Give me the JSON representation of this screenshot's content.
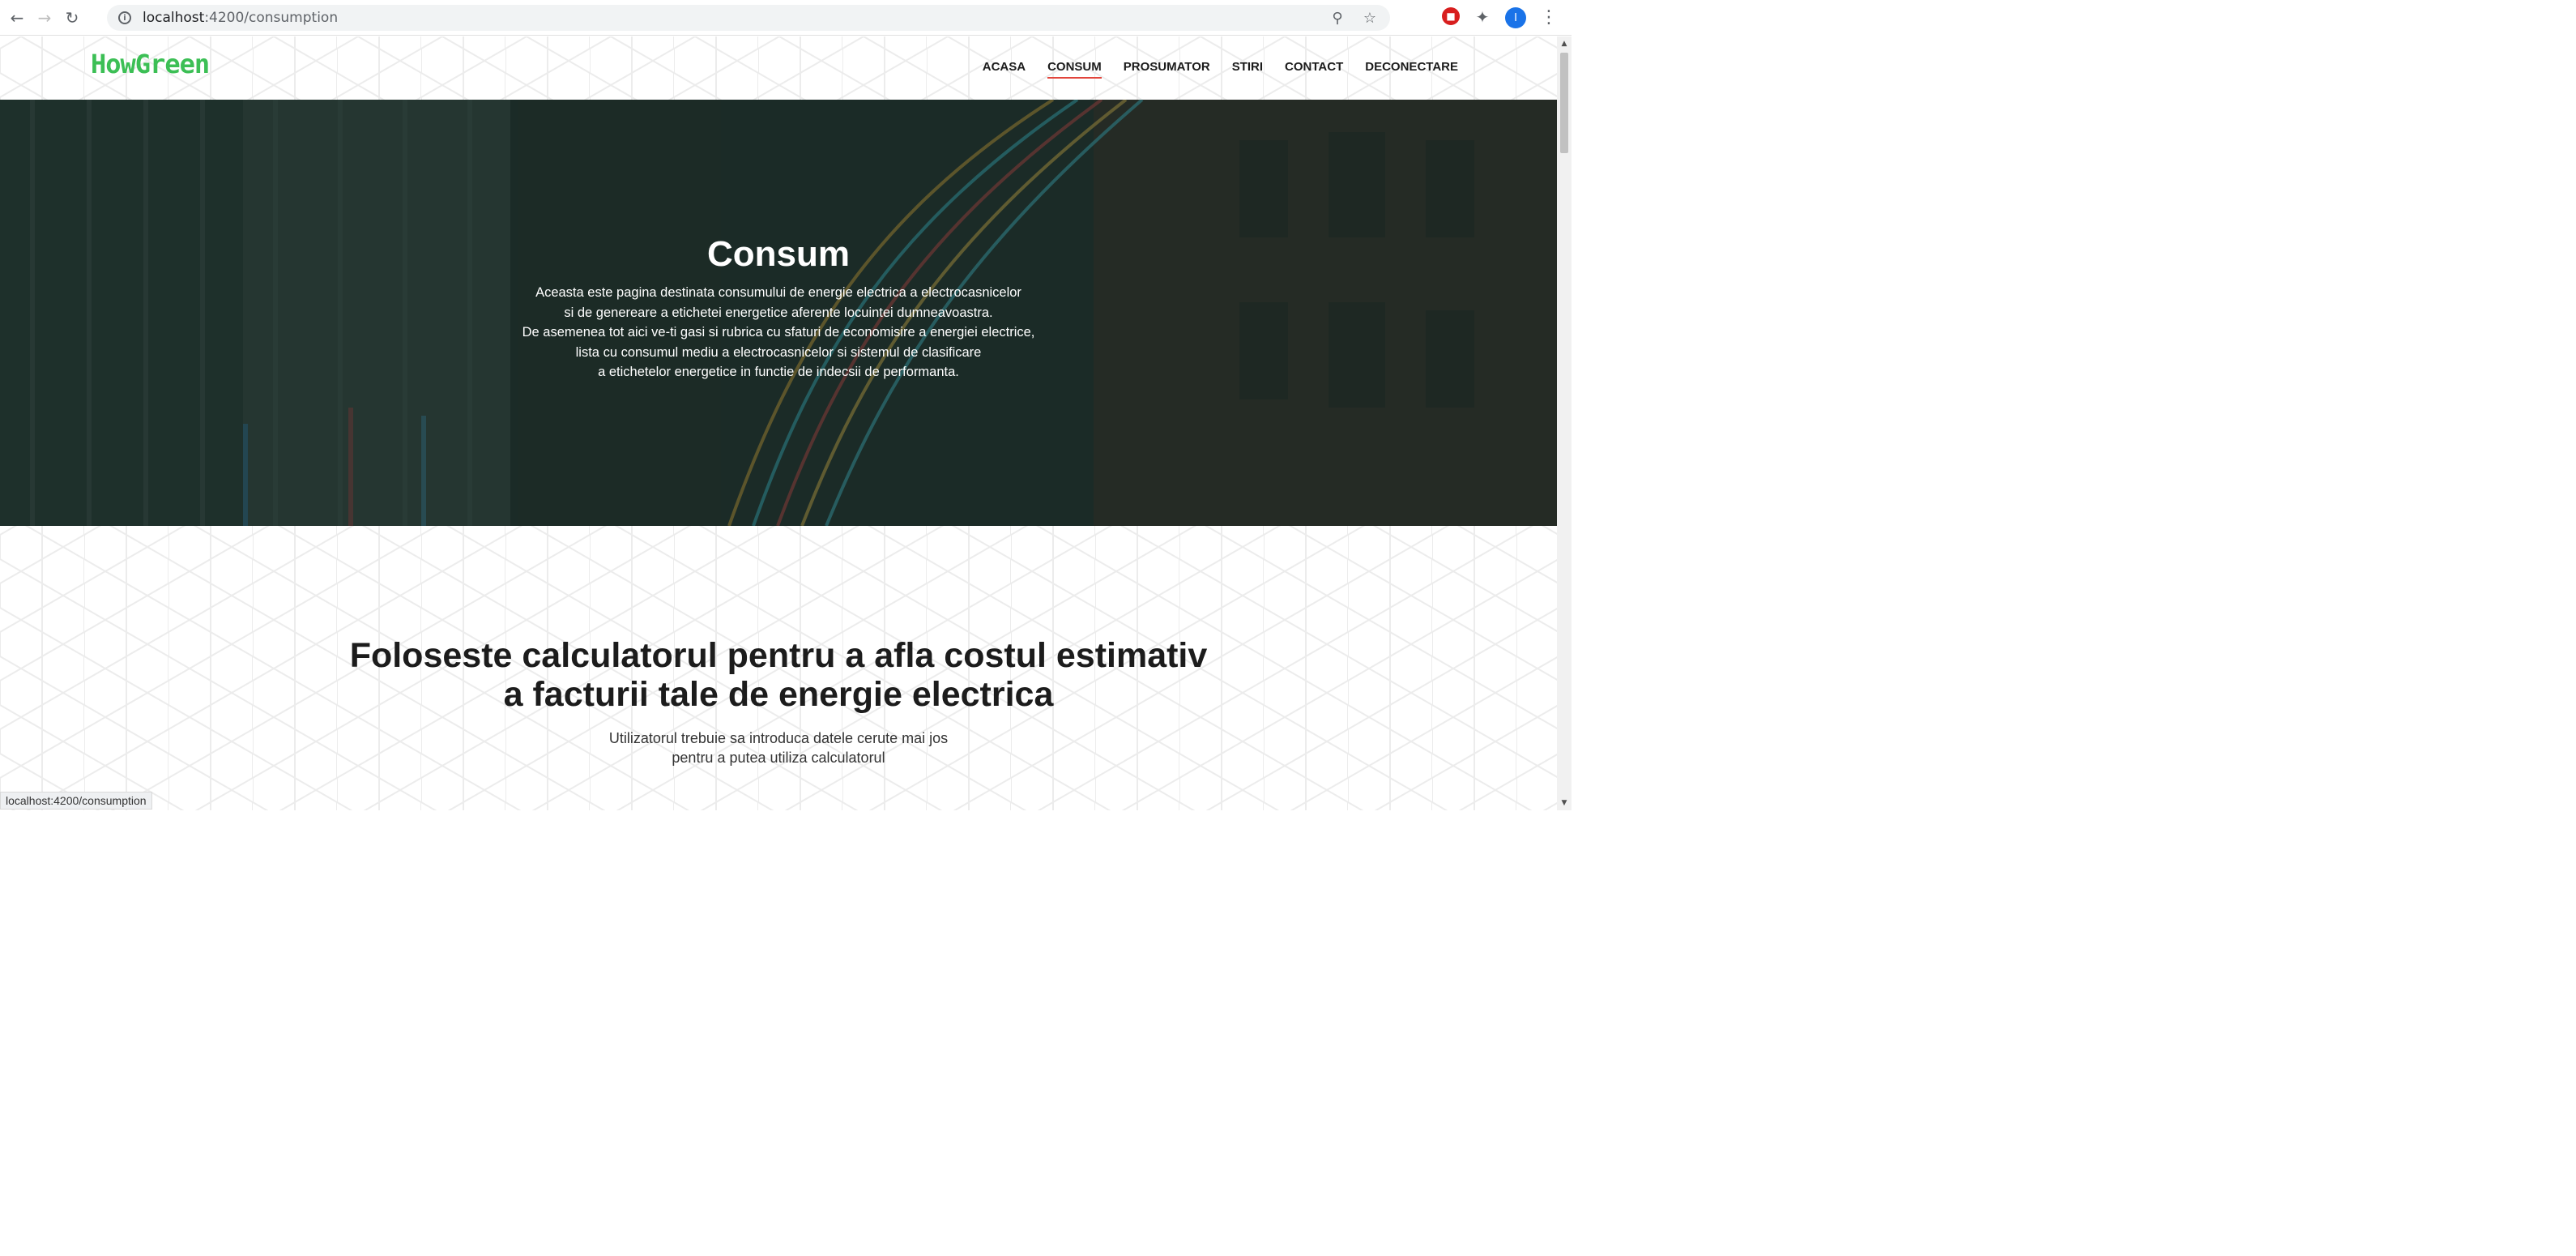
{
  "browser": {
    "url_host": "localhost",
    "url_path": ":4200/consumption",
    "profile_initial": "I"
  },
  "site": {
    "logo": "HowGreen",
    "nav": [
      {
        "label": "ACASA",
        "active": false
      },
      {
        "label": "CONSUM",
        "active": true
      },
      {
        "label": "PROSUMATOR",
        "active": false
      },
      {
        "label": "STIRI",
        "active": false
      },
      {
        "label": "CONTACT",
        "active": false
      },
      {
        "label": "DECONECTARE",
        "active": false
      }
    ],
    "accent_color": "#3cbf55",
    "active_underline_color": "#e2453c"
  },
  "hero": {
    "title": "Consum",
    "lines": [
      "Aceasta este pagina destinata consumului de energie electrica a electrocasnicelor",
      "si de genereare a etichetei energetice aferente locuintei dumneavoastra.",
      "De asemenea tot aici ve-ti gasi si rubrica cu sfaturi de economisire a energiei electrice,",
      "lista cu consumul mediu a electrocasnicelor si sistemul de clasificare",
      "a etichetelor energetice in functie de indecsii de performanta."
    ]
  },
  "calculator": {
    "title_line1": "Foloseste calculatorul pentru a afla costul estimativ",
    "title_line2": "a facturii tale de energie electrica",
    "subtitle_line1": "Utilizatorul trebuie sa introduca datele cerute mai jos",
    "subtitle_line2": "pentru a putea utiliza calculatorul"
  },
  "status_bar": {
    "link": "localhost:4200/consumption"
  }
}
